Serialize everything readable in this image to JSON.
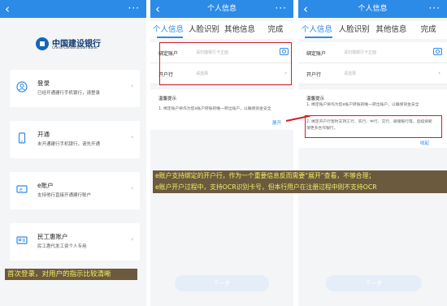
{
  "panel1": {
    "back_icon": "‹",
    "more_icon": "···",
    "logo": {
      "cn": "中国建设银行",
      "en": "China Construction Bank"
    },
    "cards": [
      {
        "icon": "user-icon",
        "title": "登录",
        "subtitle": "已经开通建行手机银行，请登录"
      },
      {
        "icon": "phone-icon",
        "title": "开通",
        "subtitle": "未开通建行手机银行，请先开通"
      },
      {
        "icon": "card-icon",
        "title": "e账户",
        "subtitle": "支持他行直接开通建行账户"
      },
      {
        "icon": "id-card-icon",
        "title": "民工惠账户",
        "subtitle": "民工惠代发工资个人专用"
      }
    ],
    "caption": "首次登录，对用户的指示比较清晰"
  },
  "panel2": {
    "title": "个人信息",
    "tabs": [
      "个人信息",
      "人脸识别",
      "其他信息",
      "完成"
    ],
    "bind_account_label": "绑定账户",
    "bind_account_placeholder": "请扫描银行卡正面",
    "open_bank_label": "开户行",
    "open_bank_placeholder": "请选择",
    "tips_title": "温馨提示",
    "tips_text": "1. 绑定账户将作为您e账户转账的唯一转出账户，以确保资金安全",
    "expand_label": "展开",
    "next_button": "下一步"
  },
  "panel3": {
    "title": "个人信息",
    "tabs": [
      "个人信息",
      "人脸识别",
      "其他信息",
      "完成"
    ],
    "bind_account_label": "绑定账户",
    "bind_account_placeholder": "请扫描银行卡正面",
    "open_bank_label": "开户行",
    "open_bank_placeholder": "请选择",
    "tips_title": "温馨提示",
    "tips_text1": "1. 绑定账户将作为您e账户转账的唯一转出账户，以确保资金安全",
    "tips_text2": "2. 绑定开户行暂时支持工行、农行、中行、交行、邮储银行等，后续将新增更多合作银行。",
    "collapse_label": "收起",
    "next_button": "下一步"
  },
  "caption2": {
    "line1": "e账户支持绑定的开户行，作为一个重要信息反而需要“展开”查看，不够合理；",
    "line2": "e账户开户过程中，支持OCR识别卡号，但本行用户在注册过程中则不支持OCR"
  },
  "colors": {
    "primary": "#2c8be6",
    "annotation": "#d21f26",
    "caption_bg": "#6b5a3e",
    "caption_text": "#f7ee64"
  }
}
